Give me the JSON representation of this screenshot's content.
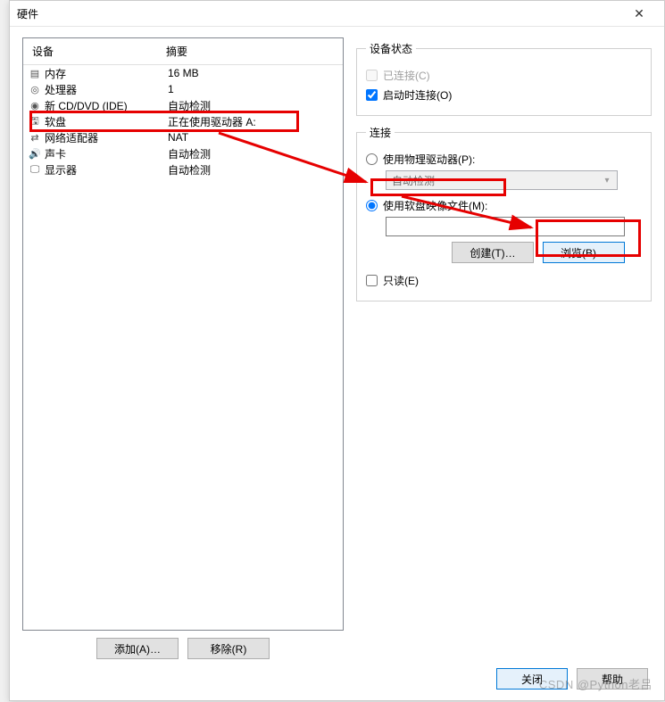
{
  "dialog": {
    "title": "硬件"
  },
  "device_table": {
    "col_device": "设备",
    "col_summary": "摘要",
    "rows": [
      {
        "icon": "memory-icon",
        "name": "内存",
        "summary": "16 MB"
      },
      {
        "icon": "cpu-icon",
        "name": "处理器",
        "summary": "1"
      },
      {
        "icon": "cd-icon",
        "name": "新 CD/DVD (IDE)",
        "summary": "自动检测"
      },
      {
        "icon": "floppy-icon",
        "name": "软盘",
        "summary": "正在使用驱动器 A:"
      },
      {
        "icon": "network-icon",
        "name": "网络适配器",
        "summary": "NAT"
      },
      {
        "icon": "sound-icon",
        "name": "声卡",
        "summary": "自动检测"
      },
      {
        "icon": "display-icon",
        "name": "显示器",
        "summary": "自动检测"
      }
    ]
  },
  "status_group": {
    "legend": "设备状态",
    "connected": "已连接(C)",
    "connect_on_power": "启动时连接(O)"
  },
  "connection_group": {
    "legend": "连接",
    "use_physical": "使用物理驱动器(P):",
    "auto_detect": "自动检测",
    "use_image": "使用软盘映像文件(M):",
    "create_btn": "创建(T)…",
    "browse_btn": "浏览(B)…",
    "readonly": "只读(E)"
  },
  "left_buttons": {
    "add": "添加(A)…",
    "remove": "移除(R)"
  },
  "footer": {
    "close": "关闭",
    "help": "帮助"
  },
  "watermark": "CSDN @Python老吕"
}
